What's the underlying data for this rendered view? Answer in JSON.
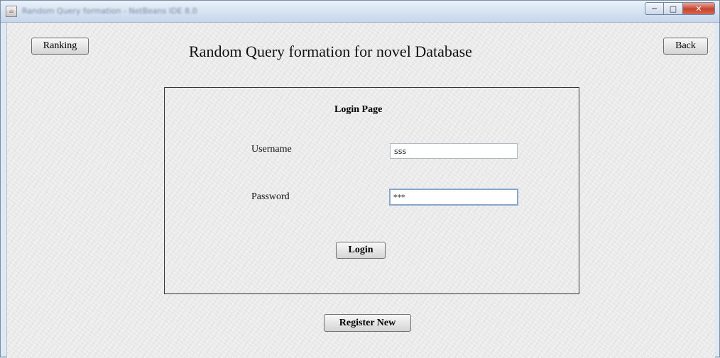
{
  "window": {
    "title": "Random Query formation - NetBeans IDE 8.0"
  },
  "toolbar": {
    "ranking_label": "Ranking",
    "back_label": "Back"
  },
  "heading": "Random Query formation for novel Database",
  "login": {
    "title": "Login Page",
    "username_label": "Username",
    "username_value": "sss",
    "password_label": "Password",
    "password_value": "***",
    "login_label": "Login"
  },
  "register_label": "Register New"
}
